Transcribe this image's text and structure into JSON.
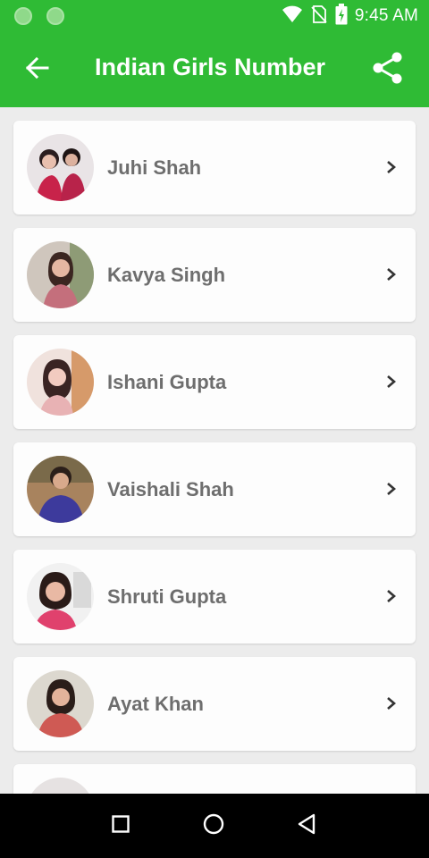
{
  "status_bar": {
    "time": "9:45 AM",
    "icons": [
      "notification-dot-icon",
      "notification-dot-icon",
      "wifi-icon",
      "no-sim-icon",
      "battery-charging-icon"
    ]
  },
  "app_bar": {
    "title": "Indian Girls Number",
    "back_icon": "arrow-back-icon",
    "share_icon": "share-icon",
    "background": "#2fbb35"
  },
  "contacts": [
    {
      "name": "Juhi Shah"
    },
    {
      "name": "Kavya Singh"
    },
    {
      "name": "Ishani Gupta"
    },
    {
      "name": "Vaishali Shah"
    },
    {
      "name": "Shruti Gupta"
    },
    {
      "name": "Ayat Khan"
    },
    {
      "name": ""
    }
  ],
  "nav_bar": {
    "buttons": [
      "recents-square-icon",
      "home-circle-icon",
      "back-triangle-icon"
    ]
  }
}
